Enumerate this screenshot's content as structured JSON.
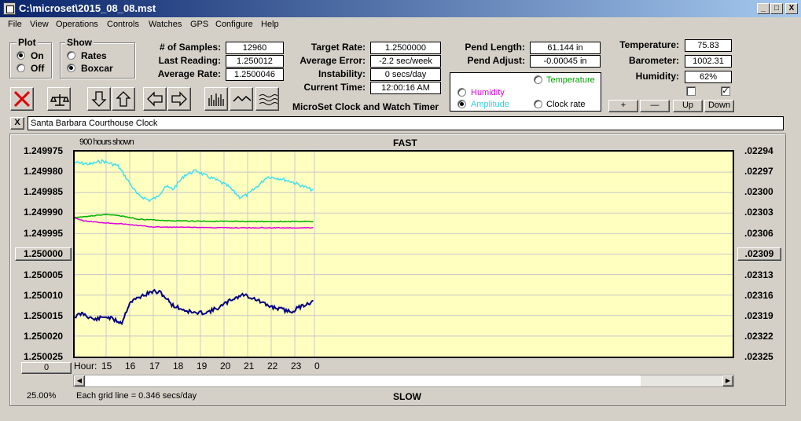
{
  "title": "C:\\microset\\2015_08_08.mst",
  "window_controls": [
    "_",
    "□",
    "X"
  ],
  "menu": [
    "File",
    "View",
    "Operations",
    "Controls",
    "Watches",
    "GPS",
    "Configure",
    "Help"
  ],
  "plot_group": {
    "legend": "Plot",
    "on": "On",
    "off": "Off",
    "selected": "On"
  },
  "show_group": {
    "legend": "Show",
    "rates": "Rates",
    "boxcar": "Boxcar",
    "selected": "Boxcar"
  },
  "stats": {
    "samples_label": "# of Samples:",
    "samples": "12960",
    "last_label": "Last Reading:",
    "last": "1.250012",
    "avg_label": "Average Rate:",
    "avg": "1.2500046",
    "target_label": "Target Rate:",
    "target": "1.2500000",
    "err_label": "Average Error:",
    "err": "-2.2 sec/week",
    "instab_label": "Instability:",
    "instab": "0 secs/day",
    "time_label": "Current Time:",
    "time": "12:00:16 AM",
    "pend_len_label": "Pend Length:",
    "pend_len": "61.144 in",
    "pend_adj_label": "Pend Adjust:",
    "pend_adj": "-0.00045 in",
    "temp_label": "Temperature:",
    "temp": "75.83",
    "baro_label": "Barometer:",
    "baro": "1002.31",
    "hum_label": "Humidity:",
    "hum": "62%"
  },
  "app_caption": "MicroSet Clock and Watch Timer",
  "sensor_radios": {
    "temperature": "Temperature",
    "humidity": "Humidity",
    "amplitude": "Amplitude",
    "clock_rate": "Clock rate",
    "selected": "Amplitude"
  },
  "checkboxes": [
    false,
    true
  ],
  "adjust_buttons": {
    "plus": "+",
    "minus": "—",
    "up": "Up",
    "down": "Down"
  },
  "note_close": "X",
  "note": "Santa Barbara Courthouse Clock",
  "plot": {
    "top_label": "FAST",
    "bottom_label": "SLOW",
    "overlay_text": "900 hours shown",
    "left_ticks": [
      "1.249975",
      "1.249980",
      "1.249985",
      "1.249990",
      "1.249995",
      "1.250000",
      "1.250005",
      "1.250010",
      "1.250015",
      "1.250020",
      "1.250025"
    ],
    "right_ticks": [
      ".02294",
      ".02297",
      ".02300",
      ".02303",
      ".02306",
      ".02309",
      ".02313",
      ".02316",
      ".02319",
      ".02322",
      ".02325"
    ],
    "center_left_button": "1.250000",
    "center_right_button": ".02309",
    "zero_button": "0",
    "hour_label": "Hour:",
    "hours": [
      "15",
      "16",
      "17",
      "18",
      "19",
      "20",
      "21",
      "22",
      "23",
      "0"
    ],
    "grid_note": "Each grid line = 0.346 secs/day",
    "zoom": "25.00%",
    "colors": {
      "rate": "#000080",
      "amplitude": "#40e0f0",
      "temperature": "#00b000",
      "humidity": "#e000e0",
      "background": "#ffffc0"
    }
  }
}
